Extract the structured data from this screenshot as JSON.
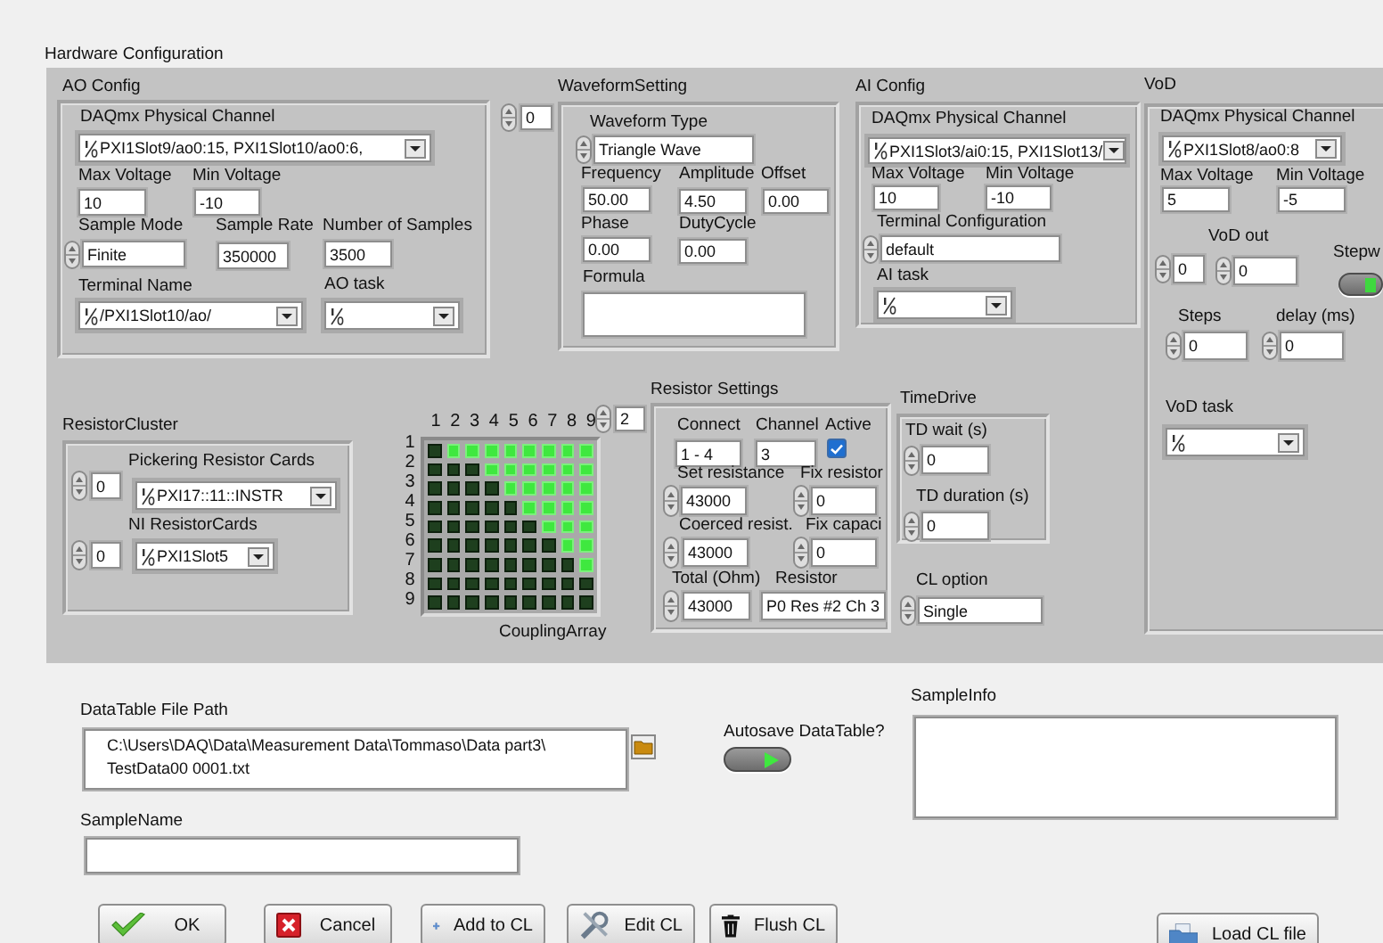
{
  "title": "Hardware Configuration",
  "ao_config": {
    "title": "AO Config",
    "physical_channel": {
      "label": "DAQmx Physical Channel",
      "value": "PXI1Slot9/ao0:15, PXI1Slot10/ao0:6,"
    },
    "max_voltage": {
      "label": "Max Voltage",
      "value": "10"
    },
    "min_voltage": {
      "label": "Min Voltage",
      "value": "-10"
    },
    "sample_mode": {
      "label": "Sample Mode",
      "value": "Finite"
    },
    "sample_rate": {
      "label": "Sample Rate",
      "value": "350000"
    },
    "number_of_samples": {
      "label": "Number of Samples",
      "value": "3500"
    },
    "terminal_name": {
      "label": "Terminal Name",
      "value": "/PXI1Slot10/ao/"
    },
    "ao_task": {
      "label": "AO task"
    }
  },
  "waveform_index": "0",
  "waveform_setting": {
    "title": "WaveformSetting",
    "waveform_type": {
      "label": "Waveform Type",
      "value": "Triangle Wave"
    },
    "frequency": {
      "label": "Frequency",
      "value": "50.00"
    },
    "amplitude": {
      "label": "Amplitude",
      "value": "4.50"
    },
    "offset": {
      "label": "Offset",
      "value": "0.00"
    },
    "phase": {
      "label": "Phase",
      "value": "0.00"
    },
    "duty_cycle": {
      "label": "DutyCycle",
      "value": "0.00"
    },
    "formula": {
      "label": "Formula"
    }
  },
  "ai_config": {
    "title": "AI Config",
    "physical_channel": {
      "label": "DAQmx Physical Channel",
      "value": "PXI1Slot3/ai0:15, PXI1Slot13/"
    },
    "max_voltage": {
      "label": "Max Voltage",
      "value": "10"
    },
    "min_voltage": {
      "label": "Min Voltage",
      "value": "-10"
    },
    "terminal_configuration": {
      "label": "Terminal Configuration",
      "value": "default"
    },
    "ai_task": {
      "label": "AI task"
    }
  },
  "vod": {
    "title": "VoD",
    "physical_channel": {
      "label": "DAQmx Physical Channel",
      "value": "PXI1Slot8/ao0:8"
    },
    "max_voltage": {
      "label": "Max Voltage",
      "value": "5"
    },
    "min_voltage": {
      "label": "Min Voltage",
      "value": "-5"
    },
    "vod_out": {
      "label": "VoD out",
      "index": "0",
      "value": "0"
    },
    "stepwise": {
      "label": "Stepw",
      "on": true
    },
    "steps": {
      "label": "Steps",
      "value": "0"
    },
    "delay": {
      "label": "delay (ms)",
      "value": "0"
    },
    "vod_task": {
      "label": "VoD task"
    }
  },
  "resistor_cluster": {
    "title": "ResistorCluster",
    "pickering": {
      "label": "Pickering Resistor Cards",
      "index": "0",
      "value": "PXI17::11::INSTR"
    },
    "ni_cards": {
      "label": "NI ResistorCards",
      "index": "0",
      "value": "PXI1Slot5"
    }
  },
  "coupling_array": {
    "label": "CouplingArray",
    "index": "2",
    "column_headers": [
      "1",
      "2",
      "3",
      "4",
      "5",
      "6",
      "7",
      "8",
      "9"
    ],
    "row_headers": [
      "1",
      "2",
      "3",
      "4",
      "5",
      "6",
      "7",
      "8",
      "9"
    ],
    "cells": [
      [
        false,
        true,
        true,
        true,
        true,
        true,
        true,
        true,
        true
      ],
      [
        false,
        false,
        false,
        true,
        true,
        true,
        true,
        true,
        true
      ],
      [
        false,
        false,
        false,
        false,
        true,
        true,
        true,
        true,
        true
      ],
      [
        false,
        false,
        false,
        false,
        false,
        true,
        true,
        true,
        true
      ],
      [
        false,
        false,
        false,
        false,
        false,
        false,
        true,
        true,
        true
      ],
      [
        false,
        false,
        false,
        false,
        false,
        false,
        false,
        true,
        true
      ],
      [
        false,
        false,
        false,
        false,
        false,
        false,
        false,
        false,
        true
      ],
      [
        false,
        false,
        false,
        false,
        false,
        false,
        false,
        false,
        false
      ],
      [
        false,
        false,
        false,
        false,
        false,
        false,
        false,
        false,
        false
      ]
    ]
  },
  "resistor_settings": {
    "title": "Resistor Settings",
    "connect": {
      "label": "Connect",
      "value": "1 - 4"
    },
    "channel": {
      "label": "Channel",
      "value": "3"
    },
    "active": {
      "label": "Active",
      "checked": true
    },
    "set_resistance": {
      "label": "Set resistance",
      "value": "43000"
    },
    "fix_resistor": {
      "label": "Fix resistor",
      "value": "0"
    },
    "coerced_resist": {
      "label": "Coerced resist.",
      "value": "43000"
    },
    "fix_capaci": {
      "label": "Fix capaci",
      "value": "0"
    },
    "total": {
      "label": "Total (Ohm)",
      "value": "43000"
    },
    "resistor": {
      "label": "Resistor",
      "value": "P0 Res #2 Ch 3"
    }
  },
  "time_drive": {
    "title": "TimeDrive",
    "td_wait": {
      "label": "TD wait (s)",
      "value": "0"
    },
    "td_duration": {
      "label": "TD duration (s)",
      "value": "0"
    },
    "cl_option": {
      "label": "CL option",
      "value": "Single"
    }
  },
  "data_table_path": {
    "label": "DataTable File Path",
    "value": "C:\\Users\\DAQ\\Data\\Measurement Data\\Tommaso\\Data part3\\\nTestData00 0001.txt"
  },
  "autosave": {
    "label": "Autosave DataTable?",
    "on": true
  },
  "sample_info": {
    "label": "SampleInfo"
  },
  "sample_name": {
    "label": "SampleName"
  },
  "buttons": [
    {
      "label": "OK",
      "kind": "ok"
    },
    {
      "label": "Cancel",
      "kind": "cancel"
    },
    {
      "label": "Add to CL",
      "kind": "add"
    },
    {
      "label": "Edit CL",
      "kind": "edit"
    },
    {
      "label": "Flush CL",
      "kind": "flush"
    },
    {
      "label": "Load CL file",
      "kind": "load"
    }
  ]
}
